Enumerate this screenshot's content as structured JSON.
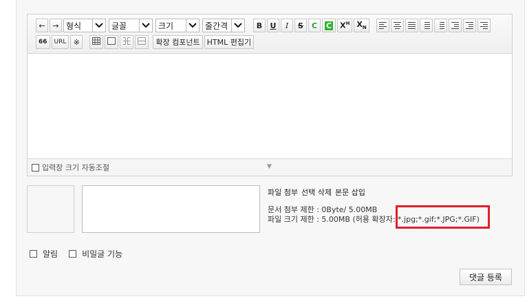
{
  "toolbar": {
    "undo_icon": "←",
    "redo_icon": "→",
    "format_select": "형식",
    "font_select": "글꼴",
    "size_select": "크기",
    "lineheight_select": "줄간격",
    "bold": "B",
    "underline": "U",
    "italic": "I",
    "strike": "S",
    "font_color": "C",
    "bg_color": "C",
    "superscript": "X",
    "superscript_mark": "H",
    "subscript": "X",
    "subscript_mark": "N",
    "quote": "66",
    "url": "URL",
    "special_char": "※",
    "expand_component_label": "확장 컴포넌트",
    "html_editor_label": "HTML 편집기"
  },
  "editor": {
    "auto_resize_label": "입력창 크기 자동조절",
    "resize_handle": "▼"
  },
  "attachments": {
    "actions": [
      "파일 첨부",
      "선택 삭제",
      "본문 삽입"
    ],
    "doc_limit": "문서 첨부 제한 : 0Byte/ 5.00MB",
    "file_limit_prefix": "파일 크기 제한 : 5.00MB (허용 확장자",
    "allowed_ext": ": *.jpg;*.gif;*.JPG;*.GIF)"
  },
  "options": {
    "notify_label": "알림",
    "secret_label": "비밀글 기능"
  },
  "submit_label": "댓글 등록",
  "colors": {
    "highlight_border": "#e01e2a",
    "font_color_green": "#2aa02a"
  }
}
